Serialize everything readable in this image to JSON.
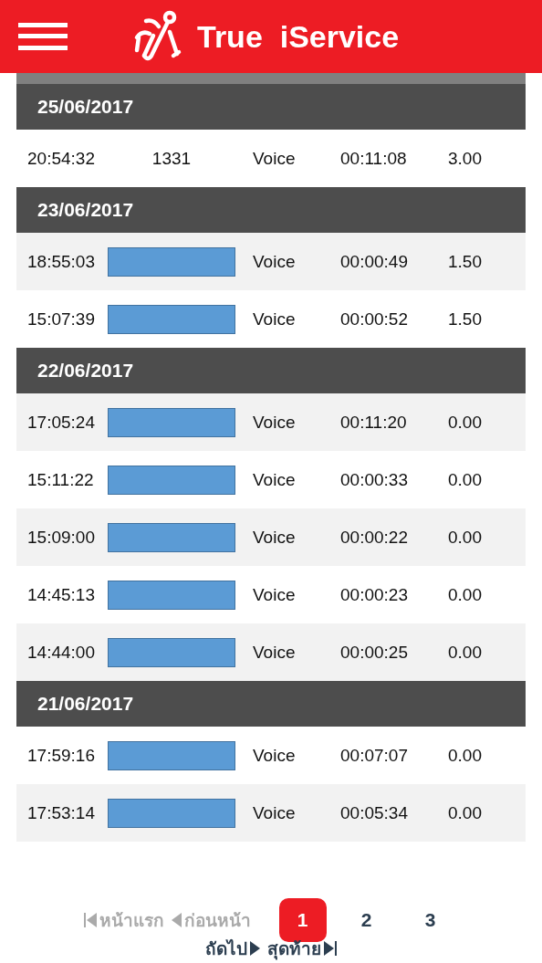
{
  "header": {
    "title": "True  iService"
  },
  "groups": [
    {
      "date": "25/06/2017",
      "rows": [
        {
          "time": "20:54:32",
          "number": "1331",
          "redacted": false,
          "type": "Voice",
          "duration": "00:11:08",
          "amount": "3.00"
        }
      ]
    },
    {
      "date": "23/06/2017",
      "rows": [
        {
          "time": "18:55:03",
          "redacted": true,
          "type": "Voice",
          "duration": "00:00:49",
          "amount": "1.50"
        },
        {
          "time": "15:07:39",
          "redacted": true,
          "type": "Voice",
          "duration": "00:00:52",
          "amount": "1.50"
        }
      ]
    },
    {
      "date": "22/06/2017",
      "rows": [
        {
          "time": "17:05:24",
          "redacted": true,
          "type": "Voice",
          "duration": "00:11:20",
          "amount": "0.00"
        },
        {
          "time": "15:11:22",
          "redacted": true,
          "type": "Voice",
          "duration": "00:00:33",
          "amount": "0.00"
        },
        {
          "time": "15:09:00",
          "redacted": true,
          "type": "Voice",
          "duration": "00:00:22",
          "amount": "0.00"
        },
        {
          "time": "14:45:13",
          "redacted": true,
          "type": "Voice",
          "duration": "00:00:23",
          "amount": "0.00"
        },
        {
          "time": "14:44:00",
          "redacted": true,
          "type": "Voice",
          "duration": "00:00:25",
          "amount": "0.00"
        }
      ]
    },
    {
      "date": "21/06/2017",
      "rows": [
        {
          "time": "17:59:16",
          "redacted": true,
          "type": "Voice",
          "duration": "00:07:07",
          "amount": "0.00"
        },
        {
          "time": "17:53:14",
          "redacted": true,
          "type": "Voice",
          "duration": "00:05:34",
          "amount": "0.00"
        }
      ]
    }
  ],
  "pagination": {
    "first": {
      "label": "หน้าแรก",
      "disabled": true
    },
    "previous": {
      "label": "ก่อนหน้า",
      "disabled": true
    },
    "pages": [
      {
        "label": "1",
        "selected": true
      },
      {
        "label": "2",
        "selected": false
      },
      {
        "label": "3",
        "selected": false
      }
    ],
    "next": {
      "label": "ถัดไป",
      "disabled": false
    },
    "last": {
      "label": "สุดท้าย",
      "disabled": false
    }
  }
}
